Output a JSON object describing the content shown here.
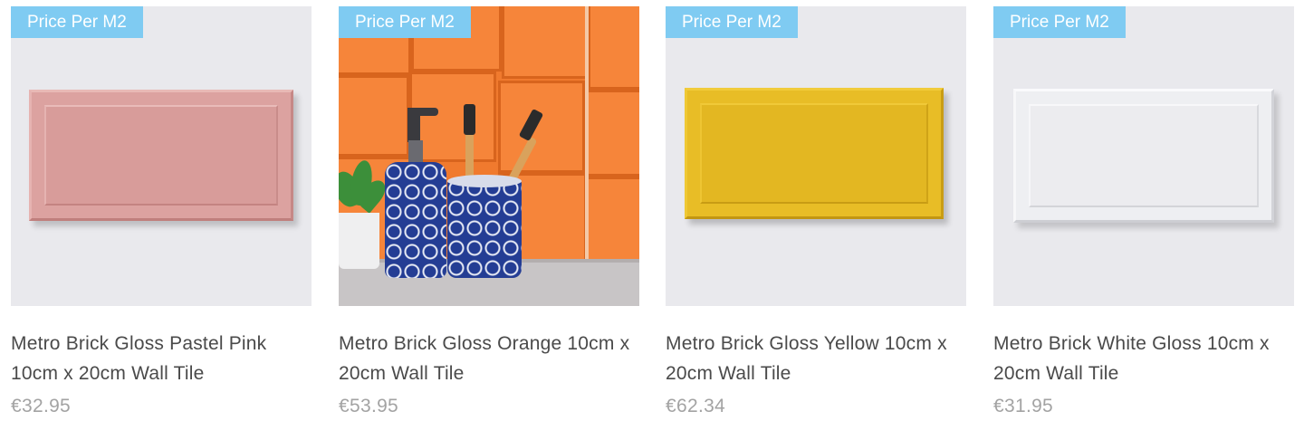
{
  "products": [
    {
      "badge": "Price Per M2",
      "title": "Metro Brick Gloss Pastel Pink 10cm x 20cm Wall Tile",
      "price": "€32.95",
      "tile_color": "#dca2a0"
    },
    {
      "badge": "Price Per M2",
      "title": "Metro Brick Gloss Orange 10cm x 20cm Wall Tile",
      "price": "€53.95",
      "tile_color": "#f07a2e"
    },
    {
      "badge": "Price Per M2",
      "title": "Metro Brick Gloss Yellow 10cm x 20cm Wall Tile",
      "price": "€62.34",
      "tile_color": "#e8bd26"
    },
    {
      "badge": "Price Per M2",
      "title": "Metro Brick White Gloss 10cm x 20cm Wall Tile",
      "price": "€31.95",
      "tile_color": "#eeeff2"
    }
  ],
  "colors": {
    "badge_background": "#7fcbf2",
    "title_text": "#4a4a4a",
    "price_text": "#a3a3a3",
    "image_background": "#e9e9ed"
  }
}
